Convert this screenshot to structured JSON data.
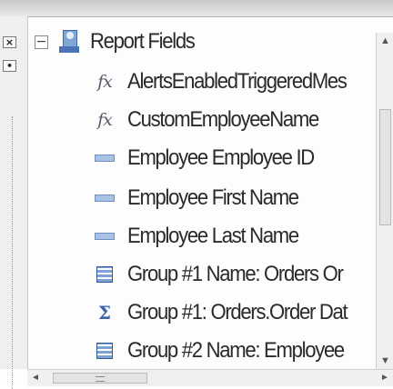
{
  "tree": {
    "root": {
      "label": "Report Fields",
      "expander": "−",
      "icon": "report-fields-icon"
    },
    "items": [
      {
        "icon": "formula-icon",
        "icon_text": "fx",
        "label": "AlertsEnabledTriggeredMes"
      },
      {
        "icon": "formula-icon",
        "icon_text": "fx",
        "label": "CustomEmployeeName"
      },
      {
        "icon": "database-field-icon",
        "label": "Employee Employee ID"
      },
      {
        "icon": "database-field-icon",
        "label": "Employee First Name"
      },
      {
        "icon": "database-field-icon",
        "label": "Employee Last Name"
      },
      {
        "icon": "group-name-icon",
        "label": "Group #1 Name: Orders Or"
      },
      {
        "icon": "summary-sigma-icon",
        "icon_text": "Σ",
        "label": "Group #1: Orders.Order Dat"
      },
      {
        "icon": "group-name-icon",
        "label": "Group #2 Name: Employee"
      }
    ]
  },
  "gutter": {
    "close_glyph": "×",
    "dot_glyph": "•"
  },
  "scrollbars": {
    "up": "▲",
    "down": "▼",
    "left": "◄",
    "right": "►"
  }
}
